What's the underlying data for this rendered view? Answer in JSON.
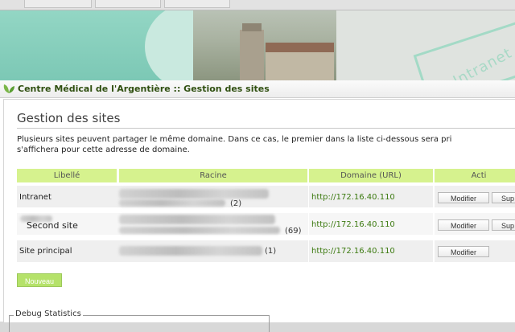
{
  "window": {
    "title": "Centre Médical de l'Argentière :: Gestion des sites"
  },
  "banner": {
    "watermark": "Intranet"
  },
  "page": {
    "heading": "Gestion des sites",
    "description_line1": "Plusieurs sites peuvent partager le même domaine. Dans ce cas, le premier dans la liste ci-dessous sera pri",
    "description_line2": "s'affichera pour cette adresse de domaine."
  },
  "table": {
    "headers": [
      "Libellé",
      "Racine",
      "Domaine (URL)",
      "Acti"
    ],
    "rows": [
      {
        "label": "Intranet",
        "count": "(2)",
        "url": "http://172.16.40.110",
        "modify": "Modifier",
        "delete": "Sup"
      },
      {
        "label": "Second site",
        "count": "(69)",
        "url": "http://172.16.40.110",
        "modify": "Modifier",
        "delete": "Sup"
      },
      {
        "label": "Site principal",
        "count": "(1)",
        "url": "http://172.16.40.110",
        "modify": "Modifier"
      }
    ]
  },
  "actions": {
    "new_label": "Nouveau"
  },
  "debug": {
    "legend": "Debug Statistics"
  },
  "colors": {
    "header_bg": "#d6f28e",
    "accent_green": "#b5e26a",
    "link_green": "#3c7a10"
  }
}
